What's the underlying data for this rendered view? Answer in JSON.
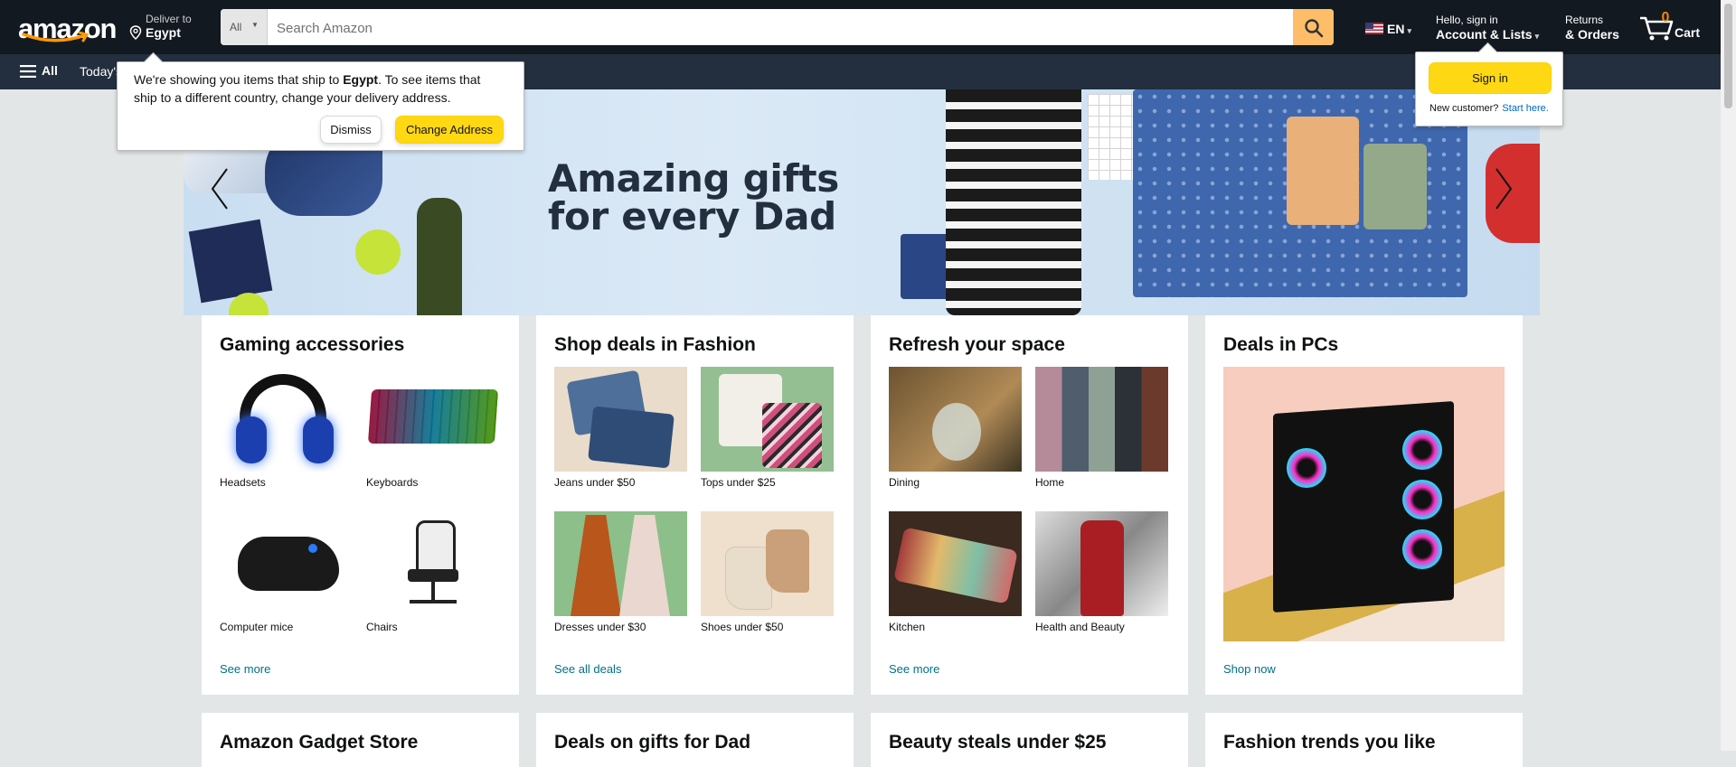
{
  "header": {
    "deliver_line1": "Deliver to",
    "deliver_line2": "Egypt",
    "search_category": "All",
    "search_placeholder": "Search Amazon",
    "lang": "EN",
    "account_line1": "Hello, sign in",
    "account_line2": "Account & Lists",
    "returns_line1": "Returns",
    "returns_line2": "& Orders",
    "cart_count": "0",
    "cart_label": "Cart"
  },
  "subnav": {
    "all_label": "All",
    "today_label": "Today's"
  },
  "hero": {
    "title_line1": "Amazing gifts",
    "title_line2": "for every Dad"
  },
  "deliver_popover": {
    "msg_part1": "We're showing you items that ship to ",
    "msg_country": "Egypt",
    "msg_part2": ". To see items that ship to a different country, change your delivery address.",
    "dismiss": "Dismiss",
    "change": "Change Address"
  },
  "signin_flyout": {
    "button": "Sign in",
    "new_customer": "New customer?",
    "start_here": "Start here."
  },
  "cards": [
    {
      "title": "Gaming accessories",
      "tiles": [
        "Headsets",
        "Keyboards",
        "Computer mice",
        "Chairs"
      ],
      "link": "See more"
    },
    {
      "title": "Shop deals in Fashion",
      "tiles": [
        "Jeans under $50",
        "Tops under $25",
        "Dresses under $30",
        "Shoes under $50"
      ],
      "link": "See all deals"
    },
    {
      "title": "Refresh your space",
      "tiles": [
        "Dining",
        "Home",
        "Kitchen",
        "Health and Beauty"
      ],
      "link": "See more"
    },
    {
      "title": "Deals in PCs",
      "link": "Shop now"
    }
  ],
  "cards_row2": [
    "Amazon Gadget Store",
    "Deals on gifts for Dad",
    "Beauty steals under $25",
    "Fashion trends you like"
  ],
  "colors": {
    "nav_dark": "#131921",
    "nav_sub": "#232f3e",
    "search_button": "#febd69",
    "primary_button": "#ffd814",
    "link": "#007185",
    "cart_count": "#f08804"
  }
}
